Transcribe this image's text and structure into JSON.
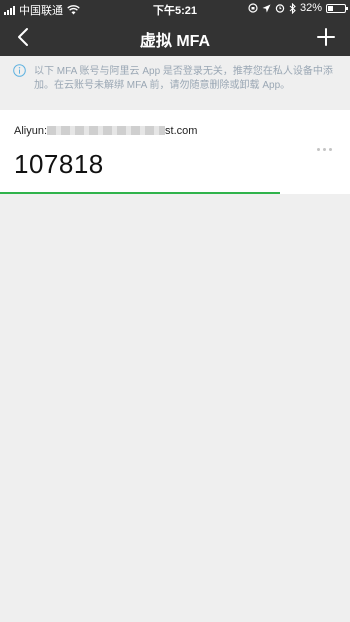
{
  "status_bar": {
    "carrier": "中国联通",
    "time": "下午5:21",
    "battery_percent_text": "32%",
    "battery_level": 0.32
  },
  "nav": {
    "title": "虚拟 MFA",
    "back_icon": "chevron-left-icon",
    "add_icon": "plus-icon"
  },
  "notice": {
    "icon": "info-icon",
    "text": "以下 MFA 账号与阿里云 App 是否登录无关，推荐您在私人设备中添加。在云账号未解绑 MFA 前，请勿随意删除或卸载 App。"
  },
  "account": {
    "prefix": "Aliyun:",
    "suffix": "st.com",
    "code": "107818",
    "time_remaining_fraction": 0.8
  },
  "colors": {
    "header_bg": "#333333",
    "accent_green": "#2fb34b",
    "notice_text": "#9aa7b4",
    "info_icon": "#5fb2e0"
  }
}
